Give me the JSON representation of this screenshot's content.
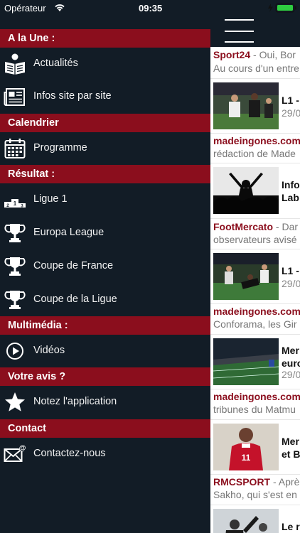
{
  "status_bar": {
    "carrier": "Opérateur",
    "time": "09:35"
  },
  "menu": {
    "sections": [
      {
        "title": "A la Une :",
        "items": [
          {
            "label": "Actualités",
            "icon": "newspaper-reader-icon"
          },
          {
            "label": "Infos site par site",
            "icon": "newspaper-icon"
          }
        ]
      },
      {
        "title": "Calendrier",
        "items": [
          {
            "label": "Programme",
            "icon": "calendar-icon"
          }
        ]
      },
      {
        "title": "Résultat :",
        "items": [
          {
            "label": "Ligue 1",
            "icon": "podium-icon"
          },
          {
            "label": "Europa League",
            "icon": "trophy-icon"
          },
          {
            "label": "Coupe de France",
            "icon": "trophy-icon"
          },
          {
            "label": "Coupe de la Ligue",
            "icon": "trophy-icon"
          }
        ]
      },
      {
        "title": "Multimédia :",
        "items": [
          {
            "label": "Vidéos",
            "icon": "play-circle-icon"
          }
        ]
      },
      {
        "title": "Votre avis ?",
        "items": [
          {
            "label": "Notez l'application",
            "icon": "star-icon"
          }
        ]
      },
      {
        "title": "Contact",
        "items": [
          {
            "label": "Contactez-nous",
            "icon": "envelope-at-icon"
          }
        ]
      }
    ]
  },
  "feed": {
    "item1": {
      "source": "Sport24",
      "sep": " - ",
      "snippet": "Oui, Bor",
      "line2": "Au cours d'un entre"
    },
    "card1": {
      "title": "L1 -",
      "date": "29/0"
    },
    "item2": {
      "source": "madeingones.com",
      "line2": "rédaction de Made"
    },
    "card2": {
      "title_l1": "Info",
      "title_l2": "Lab"
    },
    "item3": {
      "source": "FootMercato",
      "sep": " - ",
      "snippet": "Dar",
      "line2": "observateurs avisé"
    },
    "card3": {
      "title": "L1 -",
      "date": "29/0"
    },
    "item4": {
      "source": "madeingones.com",
      "line2": "Conforama, les Gir"
    },
    "card4": {
      "title_l1": "Mer",
      "title_l2": "euro",
      "date": "29/0"
    },
    "item5": {
      "source": "madeingones.com",
      "line2": "tribunes du Matmu"
    },
    "card5": {
      "title_l1": "Mer",
      "title_l2": "et B"
    },
    "item6": {
      "source": "RMCSPORT",
      "sep": " - ",
      "snippet": "Aprè",
      "line2": "Sakho, qui s'est en"
    },
    "card6": {
      "title": "Le r"
    }
  },
  "colors": {
    "accent": "#8b0e1d",
    "menu_bg": "#121c26"
  }
}
